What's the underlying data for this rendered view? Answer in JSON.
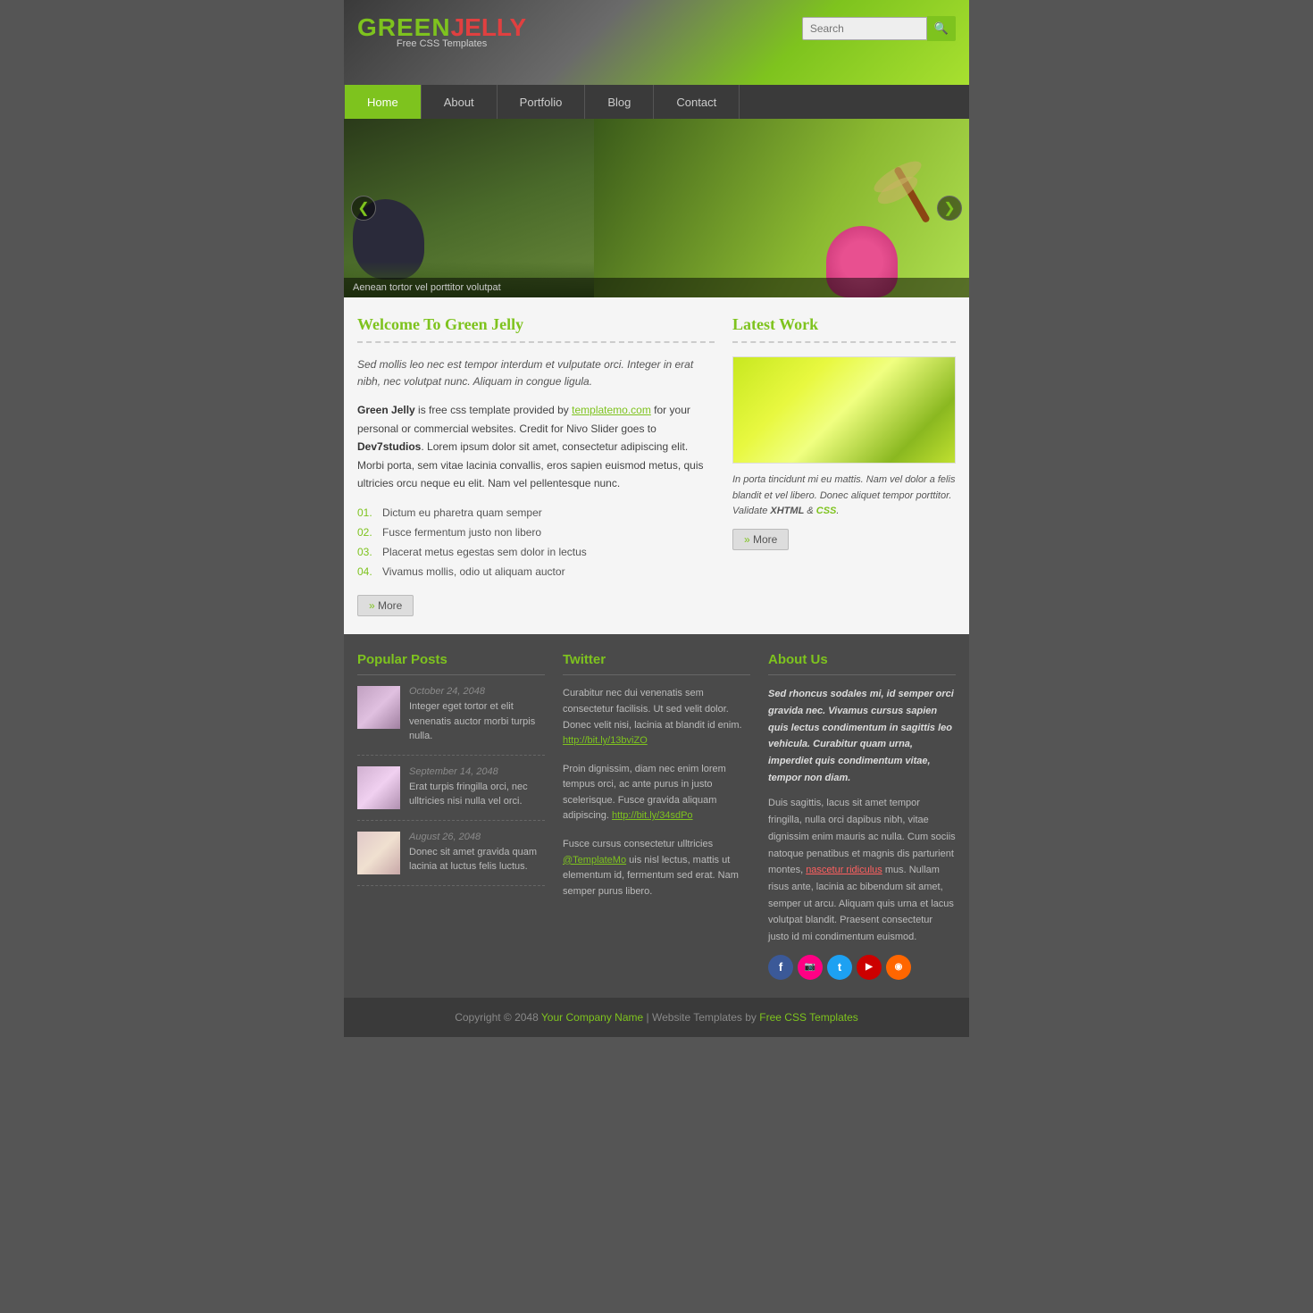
{
  "site": {
    "logo_green": "GREEN",
    "logo_jelly": "JELLY",
    "tagline": "Free CSS Templates"
  },
  "header": {
    "search_placeholder": "Search",
    "search_btn_icon": "🔍"
  },
  "nav": {
    "items": [
      {
        "label": "Home",
        "active": true
      },
      {
        "label": "About",
        "active": false
      },
      {
        "label": "Portfolio",
        "active": false
      },
      {
        "label": "Blog",
        "active": false
      },
      {
        "label": "Contact",
        "active": false
      }
    ]
  },
  "slider": {
    "caption": "Aenean tortor vel porttitor volutpat",
    "prev_label": "❮",
    "next_label": "❯"
  },
  "welcome": {
    "title": "Welcome To Green Jelly",
    "intro": "Sed mollis leo nec est tempor interdum et vulputate orci. Integer in erat nibh, nec volutpat nunc. Aliquam in congue ligula.",
    "body1": "Green Jelly is free css template provided by templatemo.com for your personal or commercial websites. Credit for Nivo Slider goes to Dev7studios. Lorem ipsum dolor sit amet, consectetur adipiscing elit. Morbi porta, sem vitae lacinia convallis, eros sapien euismod metus, quis ultricies orcu neque eu elit. Nam vel pellentesque nunc.",
    "list": [
      {
        "num": "01.",
        "text": "Dictum eu pharetra quam semper"
      },
      {
        "num": "02.",
        "text": "Fusce fermentum justo non libero"
      },
      {
        "num": "03.",
        "text": "Placerat metus egestas sem dolor in lectus"
      },
      {
        "num": "04.",
        "text": "Vivamus mollis, odio ut aliquam auctor"
      }
    ],
    "more_label": "More"
  },
  "latest_work": {
    "title": "Latest Work",
    "caption": "In porta tincidunt mi eu mattis. Nam vel dolor a felis blandit et vel libero. Donec aliquet tempor porttitor. Validate XHTML & CSS.",
    "xhtml_label": "XHTML",
    "css_label": "CSS",
    "more_label": "More"
  },
  "popular_posts": {
    "title": "Popular Posts",
    "posts": [
      {
        "date": "October 24, 2048",
        "text": "Integer eget tortor et elit venenatis auctor morbi turpis nulla."
      },
      {
        "date": "September 14, 2048",
        "text": "Erat turpis fringilla orci, nec ulltricies nisi nulla vel orci."
      },
      {
        "date": "August 26, 2048",
        "text": "Donec sit amet gravida quam lacinia at luctus felis luctus."
      }
    ]
  },
  "twitter": {
    "title": "Twitter",
    "tweets": [
      {
        "text": "Curabitur nec dui venenatis sem consectetur facilisis. Ut sed velit dolor. Donec velit nisi, lacinia at blandit id enim. ",
        "link": "http://bit.ly/13bviZO"
      },
      {
        "text": "Proin dignissim, diam nec enim lorem tempus orci, ac ante purus in justo scelerisque. Fusce gravida aliquam adipiscing. ",
        "link": "http://bit.ly/34sdPo"
      },
      {
        "text": "Fusce cursus consectetur ulltricies @TemplateMo uis nisl lectus, mattis ut elementum id, fermentum sed erat. Nam semper purus libero.",
        "link": null
      }
    ]
  },
  "about_us": {
    "title": "About Us",
    "para1": "Sed rhoncus sodales mi, id semper orci gravida nec. Vivamus cursus sapien quis lectus condimentum in sagittis leo vehicula. Curabitur quam urna, imperdiet quis condimentum vitae, tempor non diam.",
    "para2": "Duis sagittis, lacus sit amet tempor fringilla, nulla orci dapibus nibh, vitae dignissim enim mauris ac nulla. Cum sociis natoque penatibus et magnis dis parturient montes, nascetur ridiculus mus. Nullam risus ante, lacinia ac bibendum sit amet, semper ut arcu. Aliquam quis urna et lacus volutpat blandit. Praesent consectetur justo id mi condimentum euismod.",
    "highlight_text": "nascetur ridiculus",
    "social": [
      {
        "label": "f",
        "class": "si-fb",
        "name": "facebook-icon"
      },
      {
        "label": "📷",
        "class": "si-fl",
        "name": "flickr-icon"
      },
      {
        "label": "t",
        "class": "si-tw",
        "name": "twitter-icon"
      },
      {
        "label": "▶",
        "class": "si-yt",
        "name": "youtube-icon"
      },
      {
        "label": "◉",
        "class": "si-rss",
        "name": "rss-icon"
      }
    ]
  },
  "footer": {
    "text": "Copyright © 2048",
    "company": "Your Company Name",
    "separator": " | Website Templates by ",
    "link_text": "Free CSS Templates"
  }
}
